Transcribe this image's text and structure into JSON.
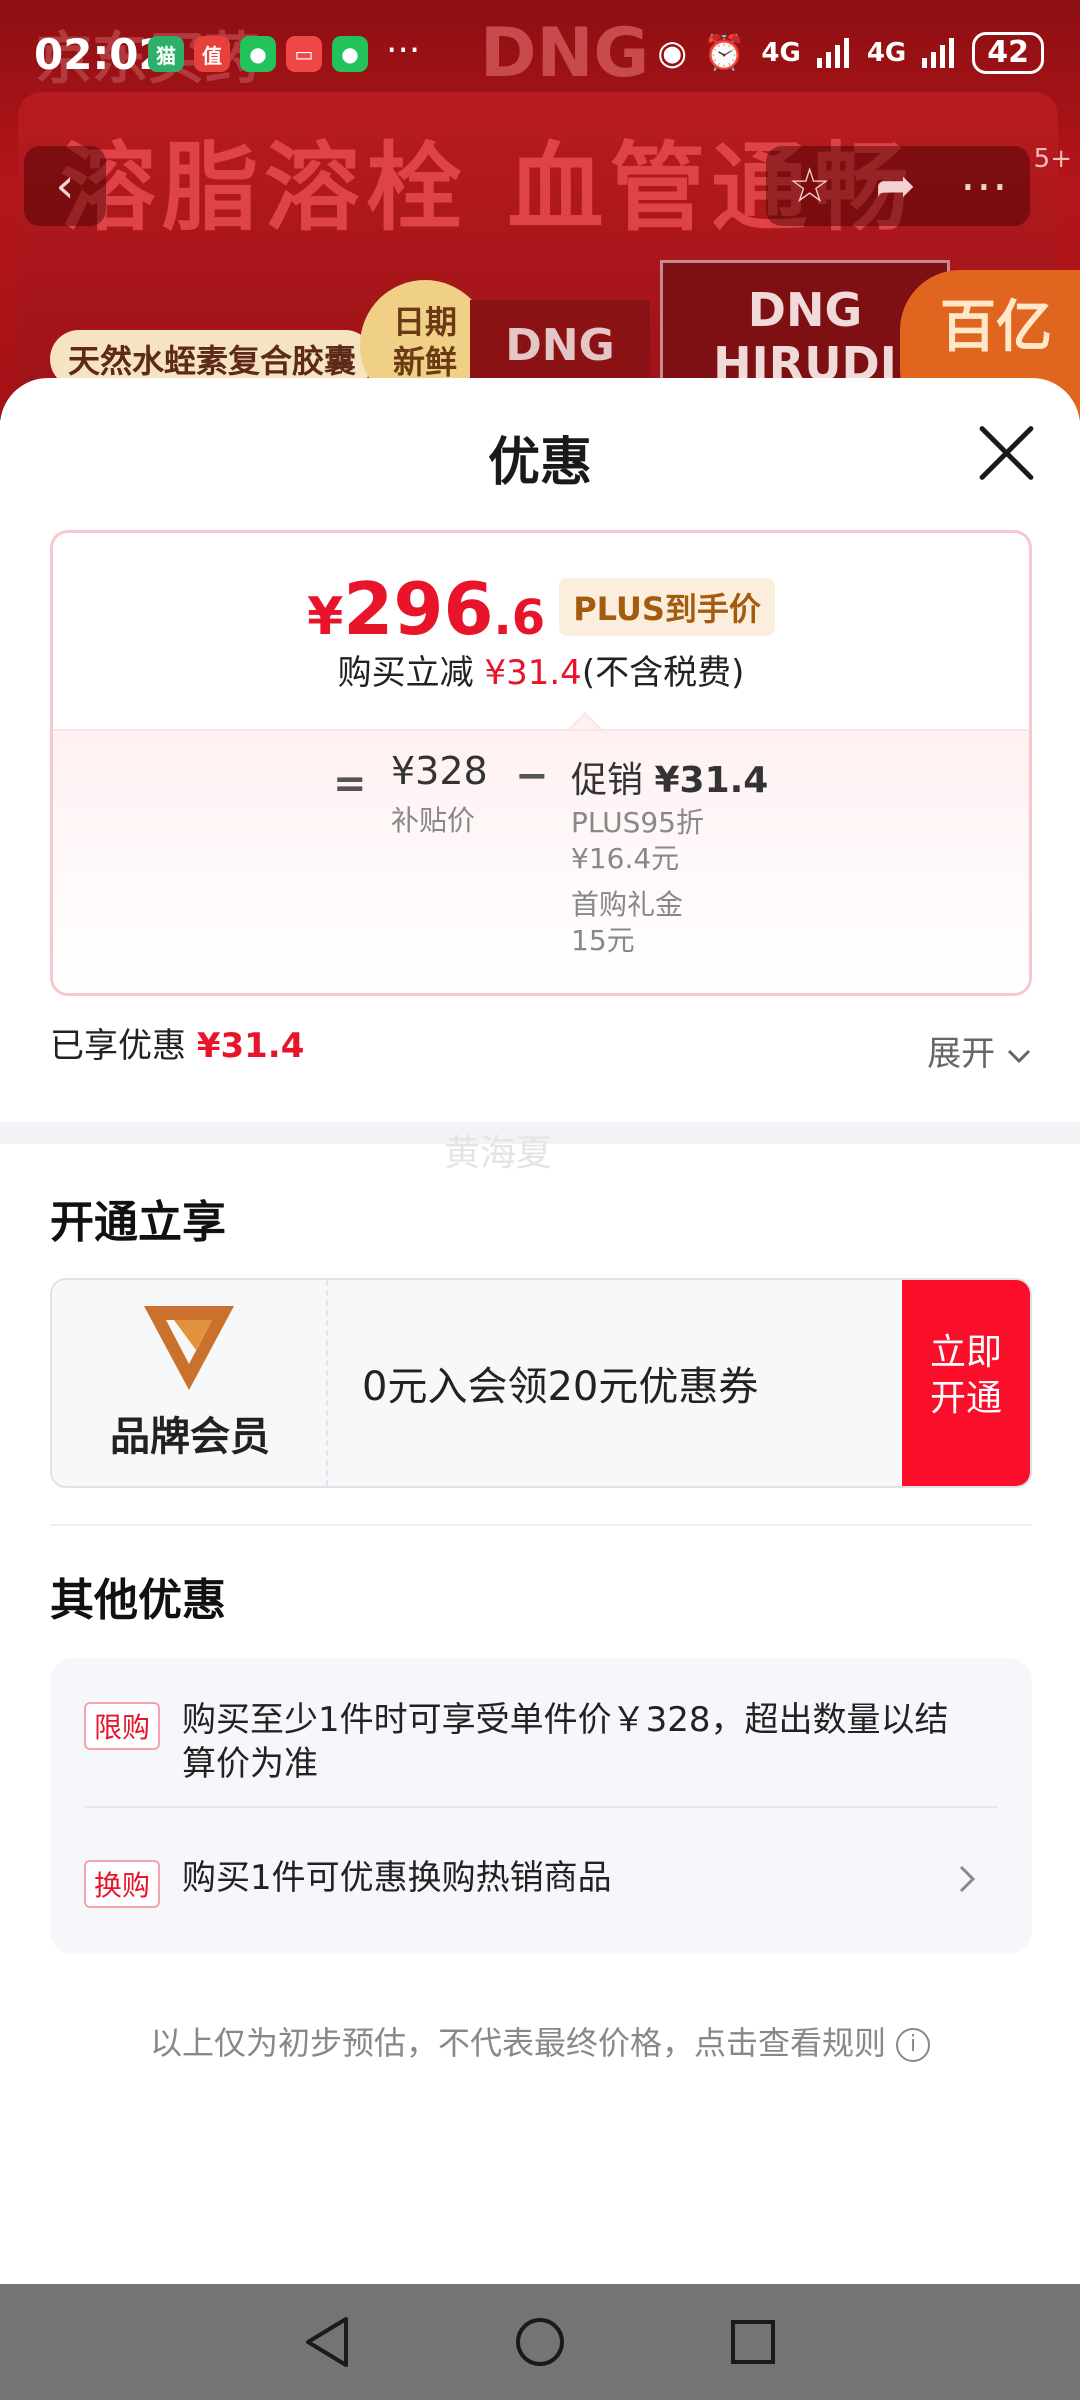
{
  "status_bar": {
    "time": "02:02",
    "more": "···",
    "signal1": "4G",
    "signal2": "4G",
    "battery": "42"
  },
  "banner": {
    "logo_left": "京东买药",
    "brand": "DNG",
    "headline": "溶脂溶栓 血管通畅",
    "tag_natural": "天然水蛭素复合胶囊",
    "tag_fresh_line1": "日期",
    "tag_fresh_line2": "新鲜",
    "box_brand": "DNG",
    "box_text": "DNG HIRUDI",
    "subsidy": "百亿补贴",
    "image_count": "5+"
  },
  "sheet": {
    "title": "优惠",
    "price": {
      "symbol": "¥",
      "integer": "296",
      "decimal": ".6",
      "tag": "PLUS到手价",
      "reduce_prefix": "购买立减",
      "reduce_amount": "¥31.4",
      "reduce_suffix": "(不含税费)",
      "equals": "=",
      "base_price": "¥328",
      "base_label": "补贴价",
      "minus": "−",
      "promo_label": "促销",
      "promo_amount": "¥31.4",
      "promo_item1_line1": "PLUS95折",
      "promo_item1_line2": "¥16.4元",
      "promo_item2_line1": "首购礼金",
      "promo_item2_line2": "15元"
    },
    "saved_label": "已享优惠",
    "saved_amount": "¥31.4",
    "expand_label": "展开",
    "watermark": "黄海夏",
    "open_section": {
      "title": "开通立享",
      "member_name": "品牌会员",
      "offer": "0元入会领20元优惠券",
      "button_line1": "立即",
      "button_line2": "开通"
    },
    "other_section": {
      "title": "其他优惠",
      "rows": [
        {
          "tag": "限购",
          "text": "购买至少1件时可享受单件价￥328，超出数量以结算价为准"
        },
        {
          "tag": "换购",
          "text": "购买1件可优惠换购热销商品"
        }
      ]
    },
    "disclaimer": "以上仅为初步预估，不代表最终价格，点击查看规则"
  },
  "colors": {
    "price_red": "#e8142a",
    "button_red": "#fb0e29",
    "plus_gold": "#a35c0f",
    "banner_red": "#a31216"
  },
  "icons": [
    "back-icon",
    "favorite-icon",
    "share-icon",
    "more-icon",
    "close-icon",
    "chevron-down-icon",
    "chevron-right-icon",
    "info-icon",
    "nav-back-icon",
    "nav-home-icon",
    "nav-recents-icon"
  ]
}
